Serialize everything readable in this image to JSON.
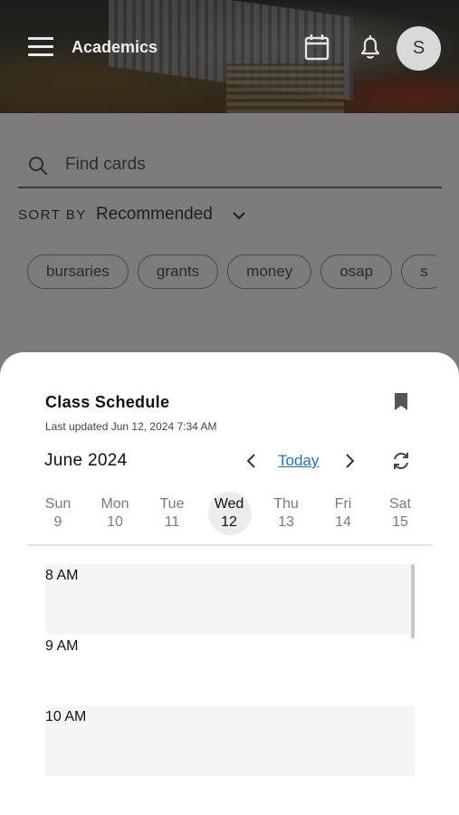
{
  "header": {
    "title": "Academics",
    "avatar_initial": "S"
  },
  "search": {
    "placeholder": "Find cards"
  },
  "sort": {
    "label": "SORT BY",
    "value": "Recommended"
  },
  "chips": [
    "bursaries",
    "grants",
    "money",
    "osap",
    "s"
  ],
  "schedule": {
    "title": "Class Schedule",
    "last_updated": "Last updated Jun 12, 2024 7:34 AM",
    "month": "June 2024",
    "today_label": "Today",
    "days": [
      {
        "name": "Sun",
        "num": "9"
      },
      {
        "name": "Mon",
        "num": "10"
      },
      {
        "name": "Tue",
        "num": "11"
      },
      {
        "name": "Wed",
        "num": "12"
      },
      {
        "name": "Thu",
        "num": "13"
      },
      {
        "name": "Fri",
        "num": "14"
      },
      {
        "name": "Sat",
        "num": "15"
      }
    ],
    "selected_day": "Wed",
    "times": [
      "8 AM",
      "9 AM",
      "10 AM"
    ]
  },
  "icons": {
    "menu": "hamburger-menu-icon",
    "calendar": "calendar-icon",
    "notifications": "bell-icon",
    "search": "search-icon",
    "sort": "chevron-down-icon",
    "bookmark": "bookmark-icon",
    "prev": "chevron-left-icon",
    "next": "chevron-right-icon",
    "refresh": "refresh-icon"
  },
  "colors": {
    "link": "#1a73c8",
    "overlay": "#7c7c7c",
    "selected_day_bg": "#ececec"
  }
}
